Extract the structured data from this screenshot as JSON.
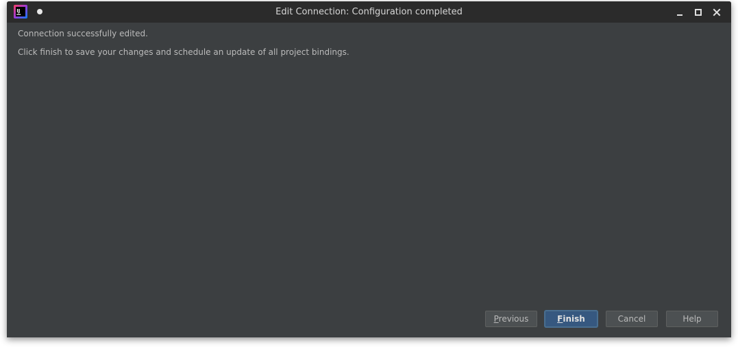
{
  "window": {
    "title": "Edit Connection: Configuration completed",
    "app_icon": "intellij-idea-icon",
    "controls": {
      "minimize_icon": "minimize-icon",
      "maximize_icon": "maximize-icon",
      "close_icon": "close-icon"
    }
  },
  "content": {
    "line1": "Connection successfully edited.",
    "line2": "Click finish to save your changes and schedule an update of all project bindings."
  },
  "buttons": {
    "previous": {
      "mnemonic": "P",
      "rest": "revious"
    },
    "finish": {
      "mnemonic": "F",
      "rest": "inish"
    },
    "cancel": "Cancel",
    "help": "Help"
  },
  "colors": {
    "background": "#3c3f41",
    "titlebar": "#2b2b2b",
    "text": "#bbbbbb",
    "default_button": "#365880"
  }
}
